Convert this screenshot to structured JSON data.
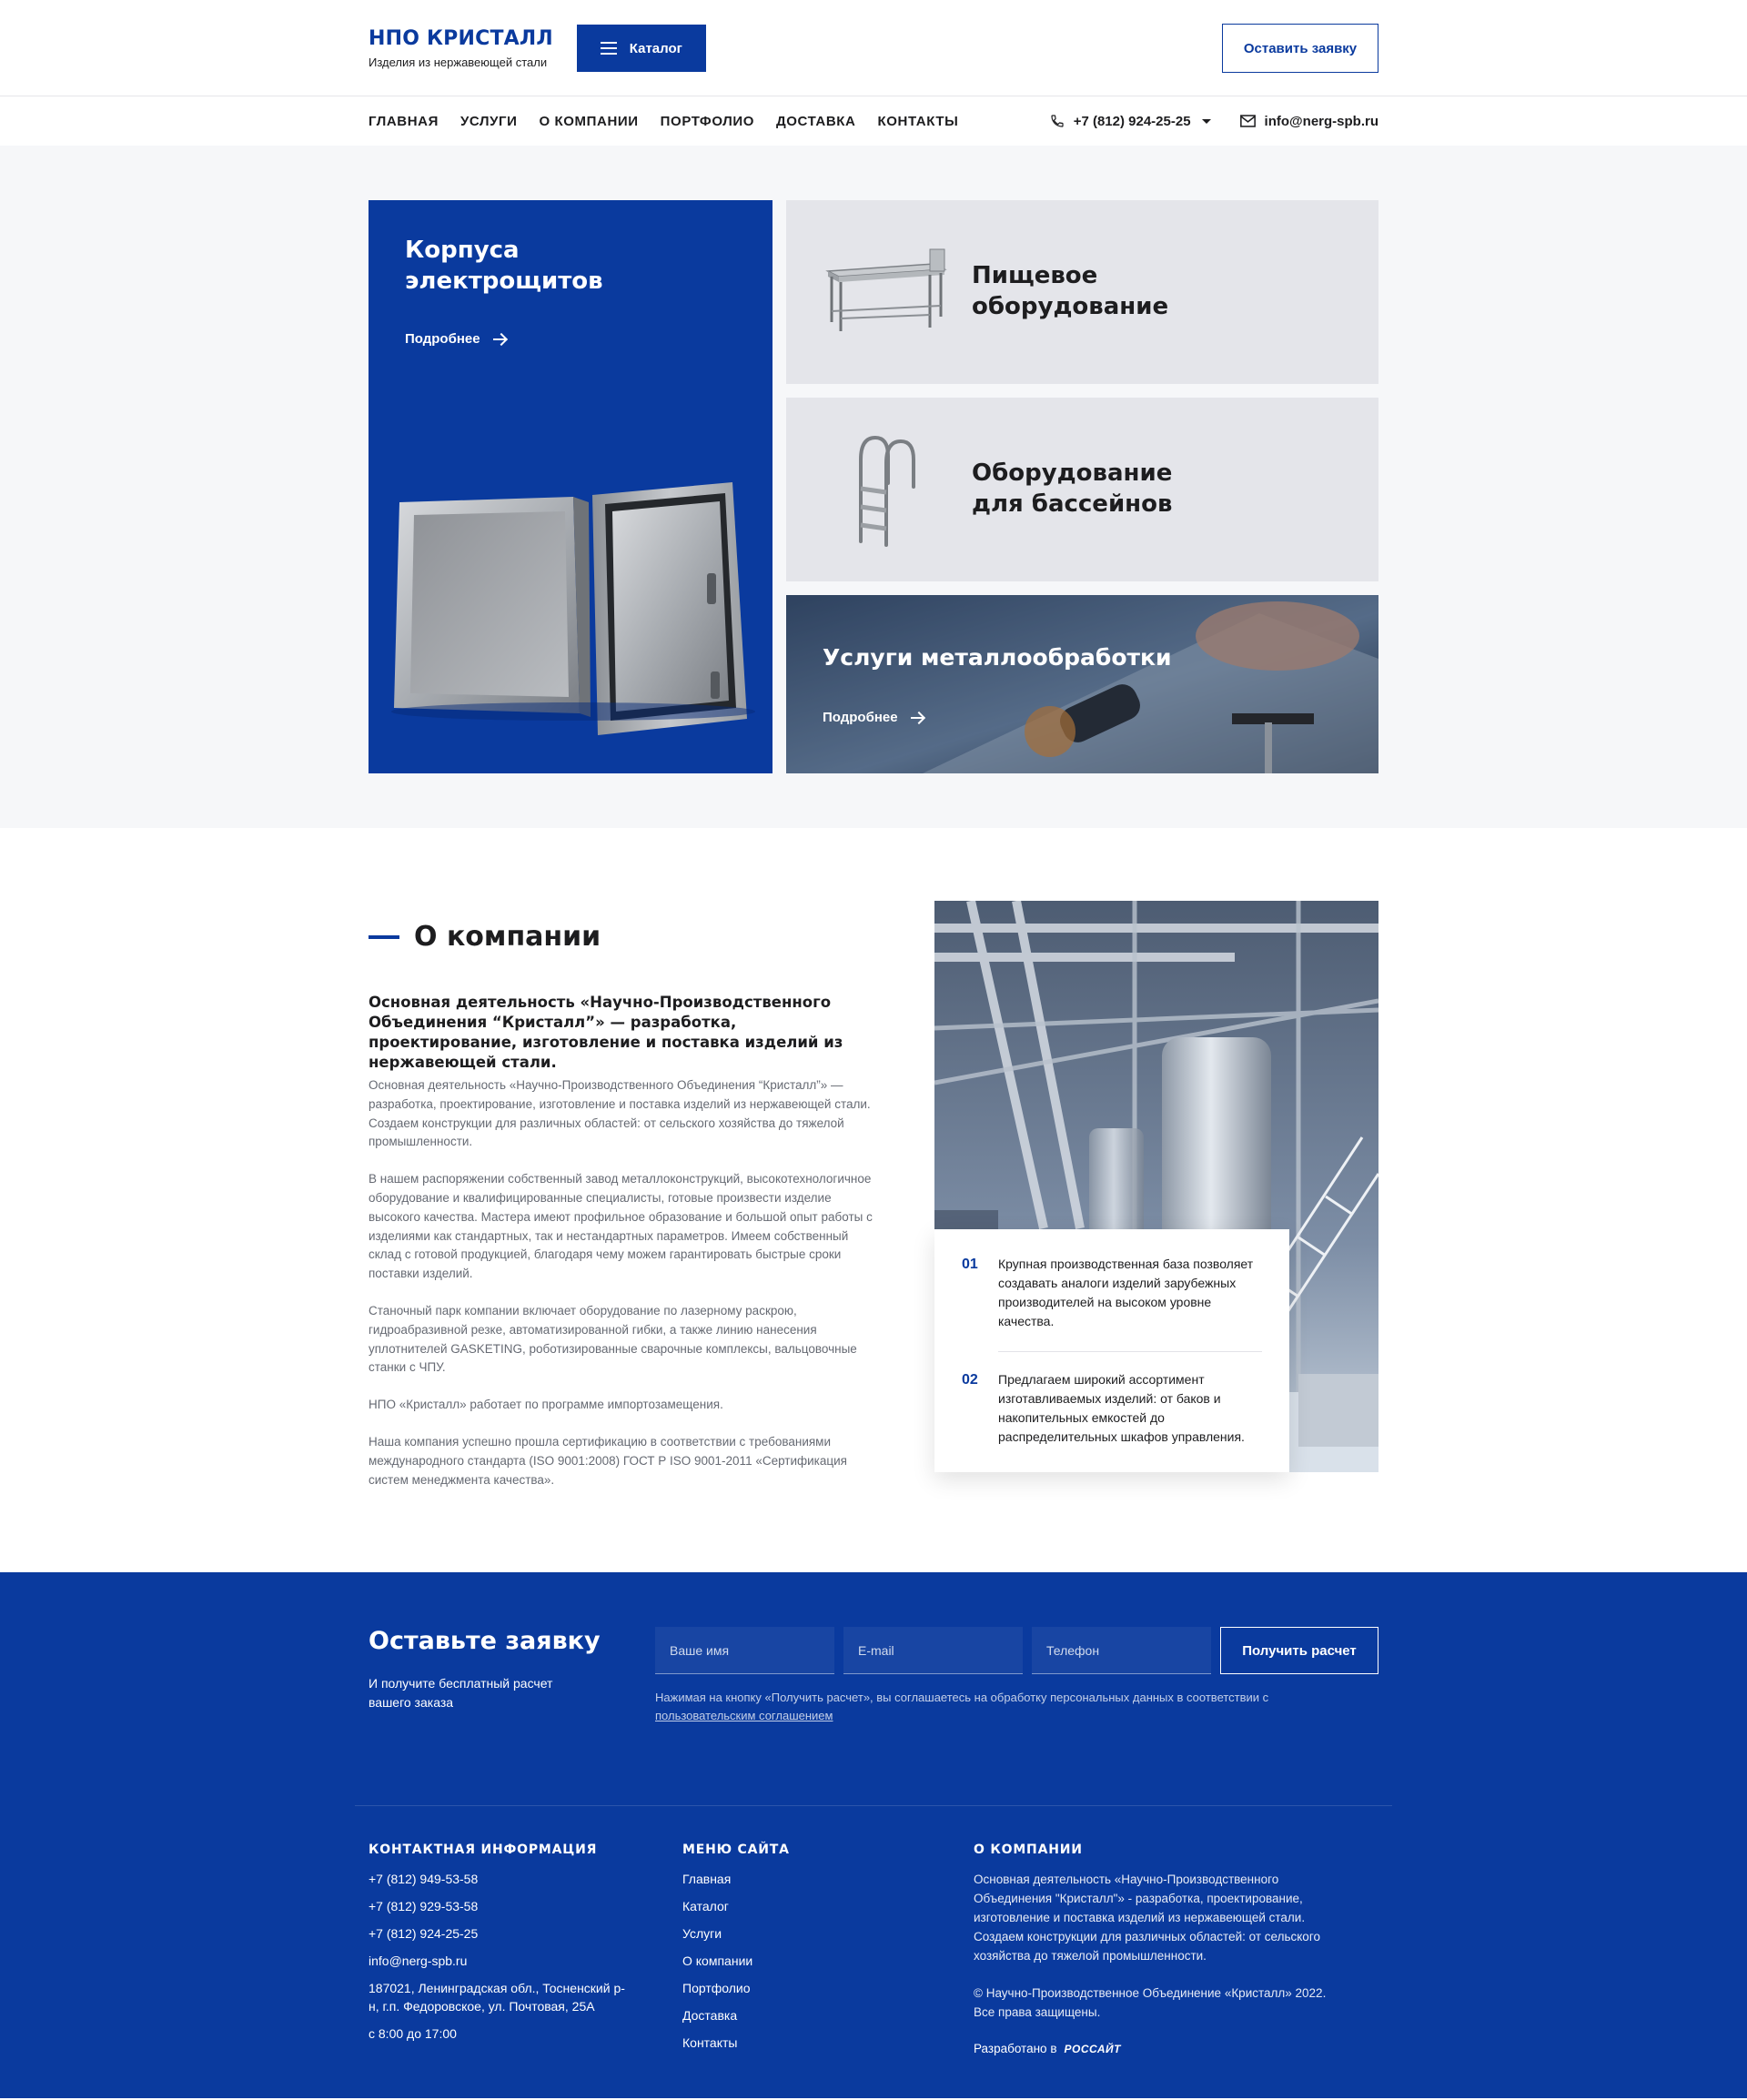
{
  "header": {
    "logo_title": "НПО КРИСТАЛЛ",
    "logo_subtitle": "Изделия из нержавеющей стали",
    "catalog_label": "Каталог",
    "request_label": "Оставить заявку"
  },
  "nav": {
    "items": [
      "ГЛАВНАЯ",
      "УСЛУГИ",
      "О КОМПАНИИ",
      "ПОРТФОЛИО",
      "ДОСТАВКА",
      "КОНТАКТЫ"
    ],
    "phone": "+7 (812) 924-25-25",
    "email": "info@nerg-spb.ru"
  },
  "hero": {
    "card1_title_line1": "Корпуса",
    "card1_title_line2": "электрощитов",
    "more_label": "Подробнее",
    "card2_title_line1": "Пищевое",
    "card2_title_line2": "оборудование",
    "card3_title_line1": "Оборудование",
    "card3_title_line2": "для бассейнов",
    "card4_title": "Услуги металлообработки"
  },
  "about": {
    "title": "О компании",
    "lead": "Основная деятельность «Научно-Производственного Объединения “Кристалл”» — разработка, проектирование, изготовление и поставка изделий из нержавеющей стали.",
    "paragraphs": [
      "Основная деятельность «Научно-Производственного Объединения “Кристалл”» — разработка, проектирование, изготовление и поставка изделий из нержавеющей стали. Создаем конструкции для различных областей: от сельского хозяйства до тяжелой промышленности.",
      "В нашем распоряжении собственный завод металлоконструкций, высокотехнологичное оборудование и квалифицированные специалисты, готовые произвести изделие высокого качества. Мастера имеют профильное образование и большой опыт работы с изделиями как стандартных, так и нестандартных параметров. Имеем собственный склад с готовой продукцией, благодаря чему можем гарантировать быстрые сроки поставки изделий.",
      "Станочный парк компании включает оборудование по лазерному раскрою, гидроабразивной резке, автоматизированной гибки, а также линию нанесения уплотнителей GASKETING, роботизированные сварочные комплексы, вальцовочные станки с ЧПУ.",
      "НПО «Кристалл» работает по программе импортозамещения.",
      "Наша компания успешно прошла сертификацию в соответствии с требованиями международного стандарта (ISO 9001:2008) ГОСТ Р ISO 9001-2011 «Сертификация систем менеджмента качества»."
    ],
    "features": [
      {
        "num": "01",
        "text": "Крупная производственная база позволяет создавать аналоги изделий зарубежных производителей на высоком уровне качества."
      },
      {
        "num": "02",
        "text": "Предлагаем широкий ассортимент изготавливаемых изделий: от баков и накопительных емкостей до распределительных шкафов управления."
      }
    ]
  },
  "request_form": {
    "title": "Оставьте заявку",
    "subtitle": "И получите бесплатный расчет вашего заказа",
    "name_placeholder": "Ваше имя",
    "email_placeholder": "E-mail",
    "phone_placeholder": "Телефон",
    "submit_label": "Получить расчет",
    "agreement_text": "Нажимая на кнопку «Получить расчет», вы соглашаетесь на обработку персональных данных в соответствии с",
    "agreement_link": "пользовательским соглашением"
  },
  "footer": {
    "contacts_title": "КОНТАКТНАЯ ИНФОРМАЦИЯ",
    "contacts": [
      "+7 (812) 949-53-58",
      "+7 (812) 929-53-58",
      "+7 (812) 924-25-25",
      "info@nerg-spb.ru",
      "187021, Ленинградская обл., Тосненский р-н, г.п. Федоровское, ул. Почтовая, 25А",
      "с 8:00 до 17:00"
    ],
    "menu_title": "МЕНЮ САЙТА",
    "menu": [
      "Главная",
      "Каталог",
      "Услуги",
      "О компании",
      "Портфолио",
      "Доставка",
      "Контакты"
    ],
    "about_title": "О КОМПАНИИ",
    "about_text": "Основная деятельность «Научно-Производственного Объединения \"Кристалл\"» - разработка, проектирование, изготовление и поставка изделий из нержавеющей стали. Создаем конструкции для различных областей: от сельского хозяйства до тяжелой промышленности.",
    "copyright": "© Научно-Производственное Объединение «Кристалл» 2022. Все права защищены.",
    "developer_label": "Разработано в",
    "developer_brand": "РОССАЙТ"
  },
  "colors": {
    "brand": "#0a3a9e",
    "hero_bg": "#f6f7f9",
    "card_gray": "#e4e5ea"
  }
}
